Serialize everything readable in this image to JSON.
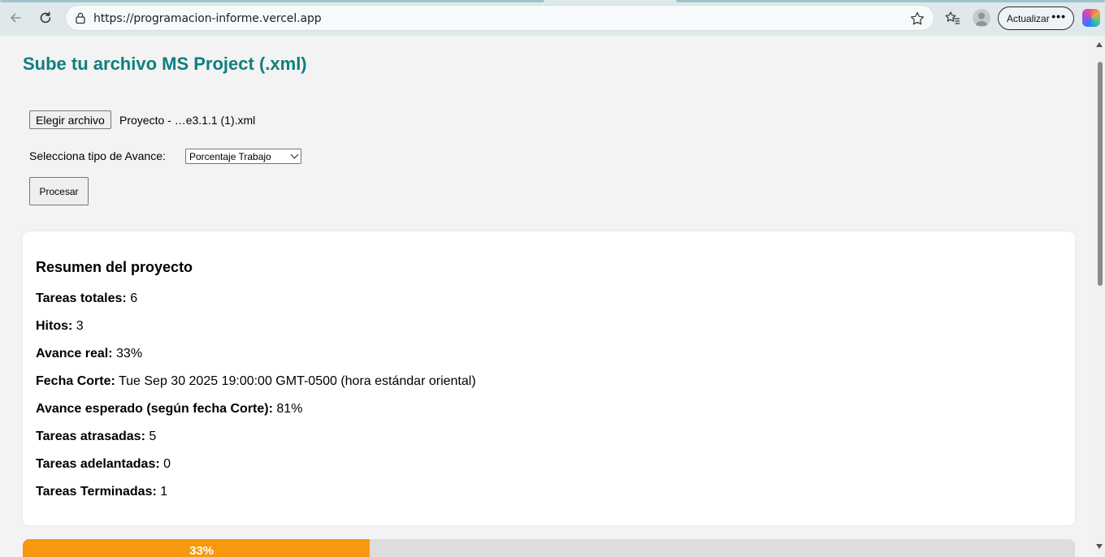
{
  "browser": {
    "url": "https://programacion-informe.vercel.app",
    "update_label": "Actualizar",
    "more_label": "•••"
  },
  "page": {
    "title": "Sube tu archivo MS Project (.xml)",
    "file_button": "Elegir archivo",
    "file_name": "Proyecto - …e3.1.1 (1).xml",
    "select_label": "Selecciona tipo de Avance:",
    "select_value": "Porcentaje Trabajo",
    "process_button": "Procesar"
  },
  "summary": {
    "heading": "Resumen del proyecto",
    "items": [
      {
        "label": "Tareas totales:",
        "value": "6"
      },
      {
        "label": "Hitos:",
        "value": "3"
      },
      {
        "label": "Avance real:",
        "value": "33%"
      },
      {
        "label": "Fecha Corte:",
        "value": "Tue Sep 30 2025 19:00:00 GMT-0500 (hora estándar oriental)"
      },
      {
        "label": "Avance esperado (según fecha Corte):",
        "value": "81%"
      },
      {
        "label": "Tareas atrasadas:",
        "value": "5"
      },
      {
        "label": "Tareas adelantadas:",
        "value": "0"
      },
      {
        "label": "Tareas Terminadas:",
        "value": "1"
      }
    ]
  },
  "progress": {
    "label": "33%",
    "fraction": 0.33,
    "fill_color": "#f7980e"
  },
  "colors": {
    "title": "#0f7f7f"
  },
  "icons": [
    "back-icon",
    "refresh-icon",
    "lock-icon",
    "star-icon",
    "favorites-icon",
    "profile-icon",
    "copilot-icon"
  ]
}
